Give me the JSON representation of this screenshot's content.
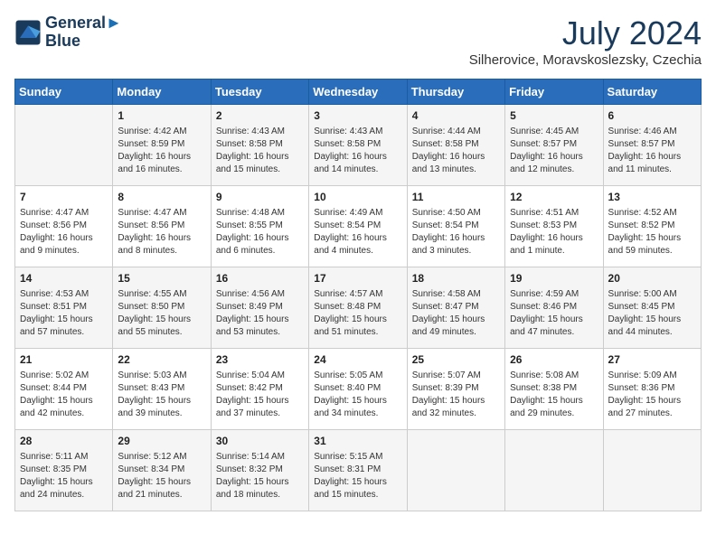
{
  "logo": {
    "line1": "General",
    "line2": "Blue"
  },
  "title": "July 2024",
  "location": "Silherovice, Moravskoslezsky, Czechia",
  "days_of_week": [
    "Sunday",
    "Monday",
    "Tuesday",
    "Wednesday",
    "Thursday",
    "Friday",
    "Saturday"
  ],
  "weeks": [
    [
      {
        "day": "",
        "info": ""
      },
      {
        "day": "1",
        "info": "Sunrise: 4:42 AM\nSunset: 8:59 PM\nDaylight: 16 hours\nand 16 minutes."
      },
      {
        "day": "2",
        "info": "Sunrise: 4:43 AM\nSunset: 8:58 PM\nDaylight: 16 hours\nand 15 minutes."
      },
      {
        "day": "3",
        "info": "Sunrise: 4:43 AM\nSunset: 8:58 PM\nDaylight: 16 hours\nand 14 minutes."
      },
      {
        "day": "4",
        "info": "Sunrise: 4:44 AM\nSunset: 8:58 PM\nDaylight: 16 hours\nand 13 minutes."
      },
      {
        "day": "5",
        "info": "Sunrise: 4:45 AM\nSunset: 8:57 PM\nDaylight: 16 hours\nand 12 minutes."
      },
      {
        "day": "6",
        "info": "Sunrise: 4:46 AM\nSunset: 8:57 PM\nDaylight: 16 hours\nand 11 minutes."
      }
    ],
    [
      {
        "day": "7",
        "info": "Sunrise: 4:47 AM\nSunset: 8:56 PM\nDaylight: 16 hours\nand 9 minutes."
      },
      {
        "day": "8",
        "info": "Sunrise: 4:47 AM\nSunset: 8:56 PM\nDaylight: 16 hours\nand 8 minutes."
      },
      {
        "day": "9",
        "info": "Sunrise: 4:48 AM\nSunset: 8:55 PM\nDaylight: 16 hours\nand 6 minutes."
      },
      {
        "day": "10",
        "info": "Sunrise: 4:49 AM\nSunset: 8:54 PM\nDaylight: 16 hours\nand 4 minutes."
      },
      {
        "day": "11",
        "info": "Sunrise: 4:50 AM\nSunset: 8:54 PM\nDaylight: 16 hours\nand 3 minutes."
      },
      {
        "day": "12",
        "info": "Sunrise: 4:51 AM\nSunset: 8:53 PM\nDaylight: 16 hours\nand 1 minute."
      },
      {
        "day": "13",
        "info": "Sunrise: 4:52 AM\nSunset: 8:52 PM\nDaylight: 15 hours\nand 59 minutes."
      }
    ],
    [
      {
        "day": "14",
        "info": "Sunrise: 4:53 AM\nSunset: 8:51 PM\nDaylight: 15 hours\nand 57 minutes."
      },
      {
        "day": "15",
        "info": "Sunrise: 4:55 AM\nSunset: 8:50 PM\nDaylight: 15 hours\nand 55 minutes."
      },
      {
        "day": "16",
        "info": "Sunrise: 4:56 AM\nSunset: 8:49 PM\nDaylight: 15 hours\nand 53 minutes."
      },
      {
        "day": "17",
        "info": "Sunrise: 4:57 AM\nSunset: 8:48 PM\nDaylight: 15 hours\nand 51 minutes."
      },
      {
        "day": "18",
        "info": "Sunrise: 4:58 AM\nSunset: 8:47 PM\nDaylight: 15 hours\nand 49 minutes."
      },
      {
        "day": "19",
        "info": "Sunrise: 4:59 AM\nSunset: 8:46 PM\nDaylight: 15 hours\nand 47 minutes."
      },
      {
        "day": "20",
        "info": "Sunrise: 5:00 AM\nSunset: 8:45 PM\nDaylight: 15 hours\nand 44 minutes."
      }
    ],
    [
      {
        "day": "21",
        "info": "Sunrise: 5:02 AM\nSunset: 8:44 PM\nDaylight: 15 hours\nand 42 minutes."
      },
      {
        "day": "22",
        "info": "Sunrise: 5:03 AM\nSunset: 8:43 PM\nDaylight: 15 hours\nand 39 minutes."
      },
      {
        "day": "23",
        "info": "Sunrise: 5:04 AM\nSunset: 8:42 PM\nDaylight: 15 hours\nand 37 minutes."
      },
      {
        "day": "24",
        "info": "Sunrise: 5:05 AM\nSunset: 8:40 PM\nDaylight: 15 hours\nand 34 minutes."
      },
      {
        "day": "25",
        "info": "Sunrise: 5:07 AM\nSunset: 8:39 PM\nDaylight: 15 hours\nand 32 minutes."
      },
      {
        "day": "26",
        "info": "Sunrise: 5:08 AM\nSunset: 8:38 PM\nDaylight: 15 hours\nand 29 minutes."
      },
      {
        "day": "27",
        "info": "Sunrise: 5:09 AM\nSunset: 8:36 PM\nDaylight: 15 hours\nand 27 minutes."
      }
    ],
    [
      {
        "day": "28",
        "info": "Sunrise: 5:11 AM\nSunset: 8:35 PM\nDaylight: 15 hours\nand 24 minutes."
      },
      {
        "day": "29",
        "info": "Sunrise: 5:12 AM\nSunset: 8:34 PM\nDaylight: 15 hours\nand 21 minutes."
      },
      {
        "day": "30",
        "info": "Sunrise: 5:14 AM\nSunset: 8:32 PM\nDaylight: 15 hours\nand 18 minutes."
      },
      {
        "day": "31",
        "info": "Sunrise: 5:15 AM\nSunset: 8:31 PM\nDaylight: 15 hours\nand 15 minutes."
      },
      {
        "day": "",
        "info": ""
      },
      {
        "day": "",
        "info": ""
      },
      {
        "day": "",
        "info": ""
      }
    ]
  ]
}
